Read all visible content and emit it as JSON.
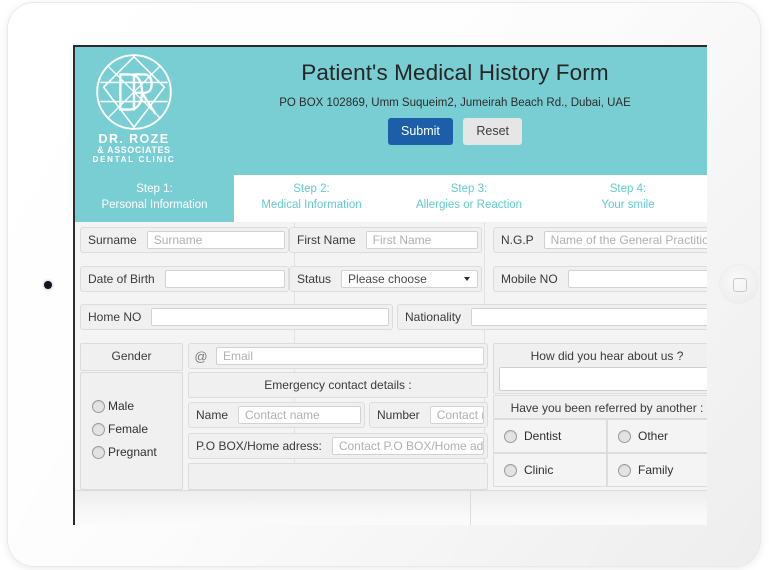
{
  "device": {
    "camera": "front-camera",
    "home_button": "home-button"
  },
  "header": {
    "title": "Patient's Medical History Form",
    "address": "PO BOX 102869, Umm Suqueim2, Jumeirah Beach Rd., Dubai, UAE",
    "submit_label": "Submit",
    "reset_label": "Reset",
    "teal": "#79ced3",
    "submit_color": "#1c5fa8",
    "logo": {
      "line1": "DR. ROZE",
      "line2": "& ASSOCIATES",
      "line3": "DENTAL CLINIC",
      "monogram": "DR"
    }
  },
  "steps": [
    {
      "num": "Step 1:",
      "label": "Personal Information",
      "active": true
    },
    {
      "num": "Step 2:",
      "label": "Medical Information",
      "active": false
    },
    {
      "num": "Step 3:",
      "label": "Allergies or Reaction",
      "active": false
    },
    {
      "num": "Step 4:",
      "label": "Your smile",
      "active": false
    }
  ],
  "form": {
    "surname": {
      "label": "Surname",
      "placeholder": "Surname",
      "value": ""
    },
    "first_name": {
      "label": "First Name",
      "placeholder": "First Name",
      "value": ""
    },
    "ngp": {
      "label": "N.G.P",
      "placeholder": "Name of the General Practitio",
      "value": ""
    },
    "dob": {
      "label": "Date of Birth",
      "placeholder": "",
      "value": ""
    },
    "status": {
      "label": "Status",
      "selected": "Please choose"
    },
    "mobile": {
      "label": "Mobile NO",
      "placeholder": "",
      "value": ""
    },
    "home_no": {
      "label": "Home NO",
      "placeholder": "",
      "value": ""
    },
    "nationality": {
      "label": "Nationality",
      "placeholder": "",
      "value": ""
    },
    "gender": {
      "label": "Gender",
      "options": [
        "Male",
        "Female",
        "Pregnant"
      ]
    },
    "email": {
      "icon": "@",
      "placeholder": "Email",
      "value": ""
    },
    "emergency": {
      "title": "Emergency contact details :",
      "name_label": "Name",
      "name_placeholder": "Contact name",
      "number_label": "Number",
      "number_placeholder": "Contact num",
      "pobox_label": "P.O BOX/Home adress:",
      "pobox_placeholder": "Contact P.O BOX/Home adres"
    },
    "hear_about": {
      "question": "How did you hear about us ?",
      "value": ""
    },
    "referred": {
      "question": "Have you been referred by another :",
      "options": [
        "Dentist",
        "Other",
        "Clinic",
        "Family"
      ]
    }
  }
}
